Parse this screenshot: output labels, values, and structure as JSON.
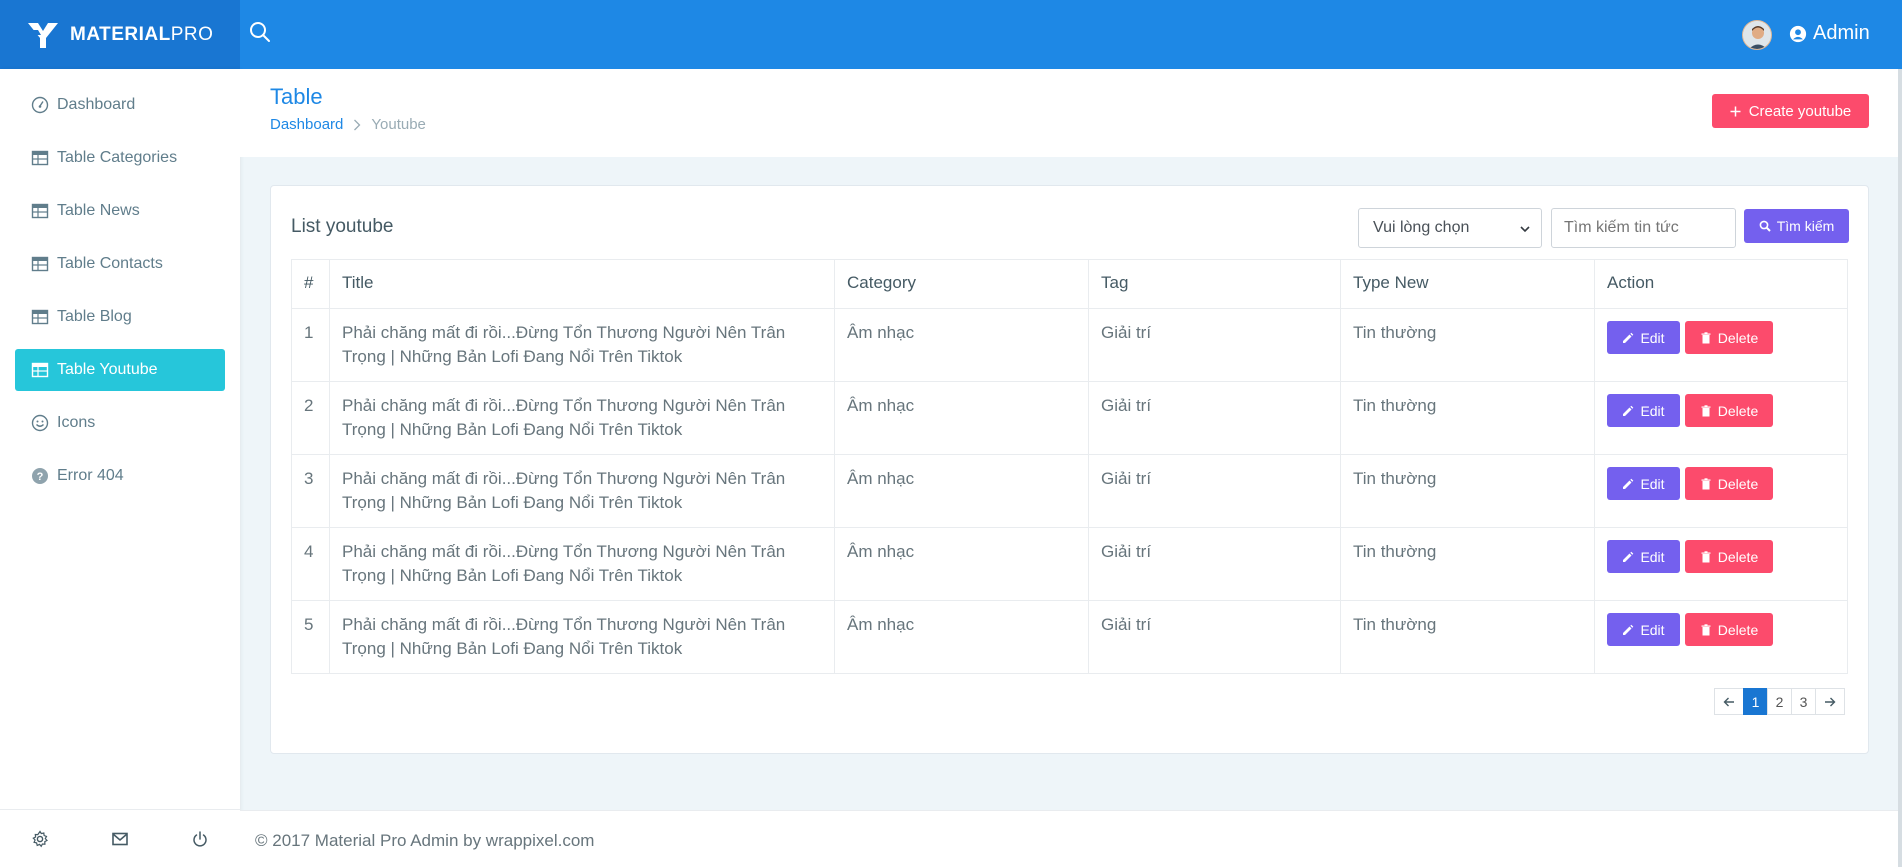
{
  "brand": {
    "bold": "MATERIAL",
    "light": "PRO"
  },
  "header": {
    "user_name": "Admin"
  },
  "sidebar": {
    "items": [
      {
        "label": "Dashboard",
        "icon": "gauge-icon"
      },
      {
        "label": "Table Categories",
        "icon": "table-icon"
      },
      {
        "label": "Table News",
        "icon": "table-icon"
      },
      {
        "label": "Table Contacts",
        "icon": "table-icon"
      },
      {
        "label": "Table Blog",
        "icon": "table-icon"
      },
      {
        "label": "Table Youtube",
        "icon": "table-icon",
        "active": true
      },
      {
        "label": "Icons",
        "icon": "smile-icon"
      },
      {
        "label": "Error 404",
        "icon": "help-icon"
      }
    ],
    "footer_icons": [
      "gear-icon",
      "mail-icon",
      "power-icon"
    ]
  },
  "page": {
    "title": "Table",
    "breadcrumb": [
      "Dashboard",
      "Youtube"
    ],
    "create_button": "Create youtube"
  },
  "card": {
    "title": "List youtube",
    "select_value": "Vui lòng chọn",
    "search_placeholder": "Tìm kiếm tin tức",
    "search_button": "Tìm kiếm",
    "columns": [
      "#",
      "Title",
      "Category",
      "Tag",
      "Type New",
      "Action"
    ],
    "rows": [
      {
        "num": "1",
        "title": "Phải chăng mất đi rồi...Đừng Tổn Thương Người Nên Trân Trọng | Những Bản Lofi Đang Nổi Trên Tiktok",
        "category": "Âm nhạc",
        "tag": "Giải trí",
        "type": "Tin thường"
      },
      {
        "num": "2",
        "title": "Phải chăng mất đi rồi...Đừng Tổn Thương Người Nên Trân Trọng | Những Bản Lofi Đang Nổi Trên Tiktok",
        "category": "Âm nhạc",
        "tag": "Giải trí",
        "type": "Tin thường"
      },
      {
        "num": "3",
        "title": "Phải chăng mất đi rồi...Đừng Tổn Thương Người Nên Trân Trọng | Những Bản Lofi Đang Nổi Trên Tiktok",
        "category": "Âm nhạc",
        "tag": "Giải trí",
        "type": "Tin thường"
      },
      {
        "num": "4",
        "title": "Phải chăng mất đi rồi...Đừng Tổn Thương Người Nên Trân Trọng | Những Bản Lofi Đang Nổi Trên Tiktok",
        "category": "Âm nhạc",
        "tag": "Giải trí",
        "type": "Tin thường"
      },
      {
        "num": "5",
        "title": "Phải chăng mất đi rồi...Đừng Tổn Thương Người Nên Trân Trọng | Những Bản Lofi Đang Nổi Trên Tiktok",
        "category": "Âm nhạc",
        "tag": "Giải trí",
        "type": "Tin thường"
      }
    ],
    "edit_label": "Edit",
    "delete_label": "Delete",
    "pagination": {
      "pages": [
        "1",
        "2",
        "3"
      ],
      "current": "1"
    }
  },
  "footer": {
    "text": "© 2017 Material Pro Admin by wrappixel.com"
  },
  "colors": {
    "primary": "#1e88e5",
    "active_nav": "#26c6da",
    "danger": "#fc4b6c",
    "purple": "#7460ee"
  }
}
